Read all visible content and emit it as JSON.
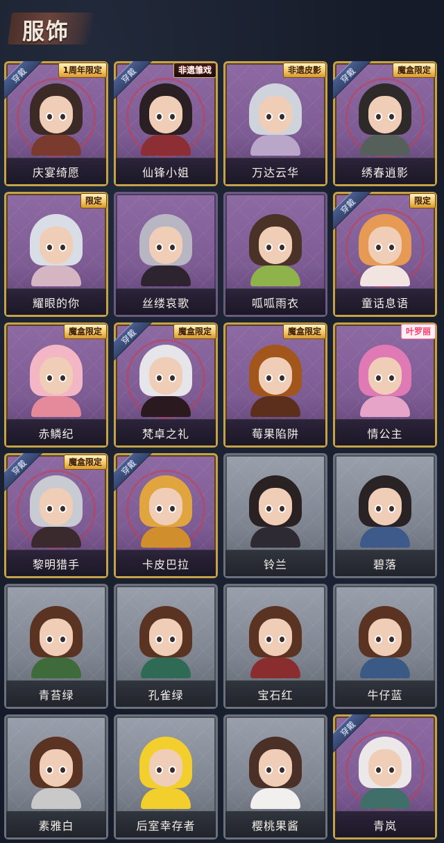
{
  "header": {
    "title": "服饰"
  },
  "colors": {
    "purple_card": "#7d5b93",
    "gray_card": "#7e848f",
    "gold_border": "#c6a34a",
    "wear_badge": "#3d4f7d"
  },
  "wear_label": "穿戴",
  "cards": [
    {
      "name": "庆宴绮愿",
      "tag": "1周年限定",
      "tag_style": "gold",
      "worn": true,
      "rarity": "purple",
      "hair": "#3b2a26",
      "body": "#7a3b2e"
    },
    {
      "name": "仙锋小姐",
      "tag": "非遗雏戏",
      "tag_style": "redtxt",
      "worn": true,
      "rarity": "purple",
      "hair": "#2a1f22",
      "body": "#8c2e34"
    },
    {
      "name": "万达云华",
      "tag": "非遗皮影",
      "tag_style": "gold",
      "worn": false,
      "rarity": "purple",
      "hair": "#cfd3dc",
      "body": "#b9a6c9"
    },
    {
      "name": "绣春逍影",
      "tag": "魔盒限定",
      "tag_style": "gold",
      "worn": true,
      "rarity": "purple",
      "hair": "#2f2a2a",
      "body": "#55605a"
    },
    {
      "name": "耀眼的你",
      "tag": "限定",
      "tag_style": "gold",
      "worn": false,
      "rarity": "purple",
      "hair": "#d9dde6",
      "body": "#d6b5c2"
    },
    {
      "name": "丝缕哀歌",
      "tag": "",
      "tag_style": "",
      "worn": false,
      "rarity": "purple",
      "hair": "#b9b6c3",
      "body": "#2d2430"
    },
    {
      "name": "呱呱雨衣",
      "tag": "",
      "tag_style": "",
      "worn": false,
      "rarity": "purple",
      "hair": "#4a3326",
      "body": "#8db34a"
    },
    {
      "name": "童话息语",
      "tag": "限定",
      "tag_style": "gold",
      "worn": true,
      "rarity": "purple",
      "hair": "#e69a54",
      "body": "#f2e5e1"
    },
    {
      "name": "赤鳞纪",
      "tag": "魔盒限定",
      "tag_style": "gold",
      "worn": false,
      "rarity": "purple",
      "hair": "#f2b6c4",
      "body": "#e58a9a"
    },
    {
      "name": "梵卓之礼",
      "tag": "魔盒限定",
      "tag_style": "gold",
      "worn": true,
      "rarity": "purple",
      "hair": "#e5e5ea",
      "body": "#2a1a20"
    },
    {
      "name": "莓果陷阱",
      "tag": "魔盒限定",
      "tag_style": "gold",
      "worn": false,
      "rarity": "purple",
      "hair": "#a2561c",
      "body": "#5c2e1c"
    },
    {
      "name": "情公主",
      "tag": "叶罗丽",
      "tag_style": "pink",
      "worn": false,
      "rarity": "purple",
      "hair": "#e07ab4",
      "body": "#e6a5c8"
    },
    {
      "name": "黎明猎手",
      "tag": "魔盒限定",
      "tag_style": "gold",
      "worn": true,
      "rarity": "purple",
      "hair": "#c9cbd2",
      "body": "#3a2a2e"
    },
    {
      "name": "卡皮巴拉",
      "tag": "",
      "tag_style": "",
      "worn": true,
      "rarity": "purple",
      "hair": "#e0a53e",
      "body": "#d08e2c"
    },
    {
      "name": "铃兰",
      "tag": "",
      "tag_style": "",
      "worn": false,
      "rarity": "gray",
      "hair": "#2a2222",
      "body": "#2d2a33"
    },
    {
      "name": "碧落",
      "tag": "",
      "tag_style": "",
      "worn": false,
      "rarity": "gray",
      "hair": "#2a2326",
      "body": "#3e5a8a"
    },
    {
      "name": "青苔绿",
      "tag": "",
      "tag_style": "",
      "worn": false,
      "rarity": "gray",
      "hair": "#5a3322",
      "body": "#3f6a3a"
    },
    {
      "name": "孔雀绿",
      "tag": "",
      "tag_style": "",
      "worn": false,
      "rarity": "gray",
      "hair": "#5a3322",
      "body": "#2f6a55"
    },
    {
      "name": "宝石红",
      "tag": "",
      "tag_style": "",
      "worn": false,
      "rarity": "gray",
      "hair": "#5a3322",
      "body": "#8a2d2f"
    },
    {
      "name": "牛仔蓝",
      "tag": "",
      "tag_style": "",
      "worn": false,
      "rarity": "gray",
      "hair": "#5a3322",
      "body": "#3a5a85"
    },
    {
      "name": "素雅白",
      "tag": "",
      "tag_style": "",
      "worn": false,
      "rarity": "gray",
      "hair": "#5a3322",
      "body": "#c9c9c9"
    },
    {
      "name": "后室幸存者",
      "tag": "",
      "tag_style": "",
      "worn": false,
      "rarity": "gray",
      "hair": "#f2cf2c",
      "body": "#f2cf2c"
    },
    {
      "name": "樱桃果酱",
      "tag": "",
      "tag_style": "",
      "worn": false,
      "rarity": "gray",
      "hair": "#4a3026",
      "body": "#f2f0ee"
    },
    {
      "name": "青岚",
      "tag": "",
      "tag_style": "",
      "worn": true,
      "rarity": "purple",
      "hair": "#ece8ea",
      "body": "#3f6f68"
    }
  ]
}
